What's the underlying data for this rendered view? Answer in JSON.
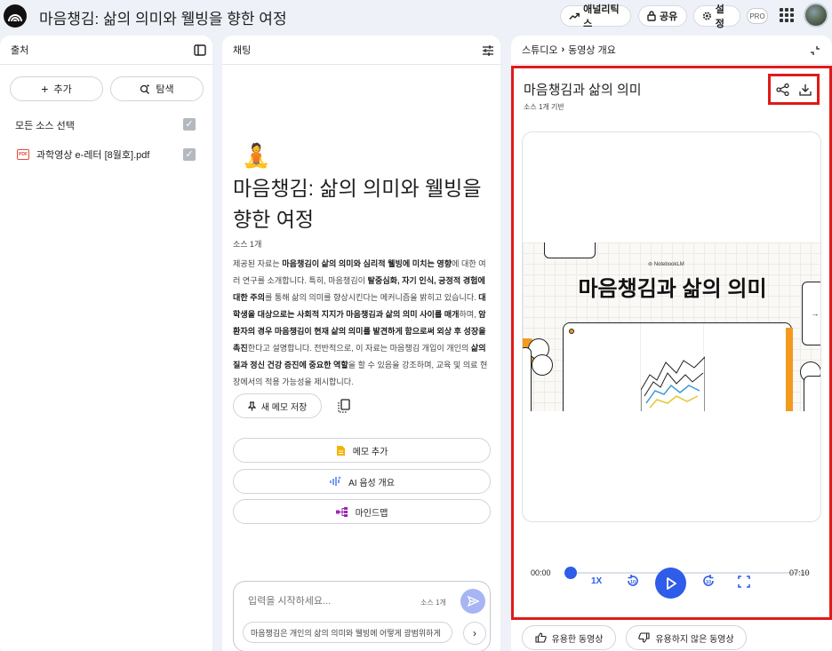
{
  "header": {
    "app_title": "마음챙김: 삶의 의미와 웰빙을 향한 여정",
    "analytics_label": "애널리틱스",
    "share_label": "공유",
    "settings_label": "설정",
    "plan_badge": "PRO"
  },
  "sources": {
    "title": "출처",
    "add_label": "추가",
    "explore_label": "탐색",
    "select_all_label": "모든 소스 선택",
    "items": [
      {
        "name": "과학영상 e-레터 [8월호].pdf",
        "type_badge": "PDF"
      }
    ]
  },
  "chat": {
    "title": "채팅",
    "notebook_emoji": "🧘",
    "notebook_title": "마음챙김: 삶의 의미와 웰빙을 향한 여정",
    "source_count": "소스 1개",
    "summary": [
      {
        "t": "제공된 자료는 ",
        "b": false
      },
      {
        "t": "마음챙김이 삶의 의미와 심리적 웰빙에 미치는 영향",
        "b": true
      },
      {
        "t": "에 대한 여러 연구를 소개합니다. 특히, 마음챙김이 ",
        "b": false
      },
      {
        "t": "탈중심화, 자기 인식, 긍정적 경험에 대한 주의",
        "b": true
      },
      {
        "t": "를 통해 삶의 의미를 향상시킨다는 메커니즘을 밝히고 있습니다. ",
        "b": false
      },
      {
        "t": "대학생을 대상으로는 사회적 지지가 마음챙김과 삶의 의미 사이를 매개",
        "b": true
      },
      {
        "t": "하며, ",
        "b": false
      },
      {
        "t": "암 환자의 경우 마음챙김이 현재 삶의 의미를 발견하게 함으로써 외상 후 성장을 촉진",
        "b": true
      },
      {
        "t": "한다고 설명합니다. 전반적으로, 이 자료는 마음챙김 개입이 개인의 ",
        "b": false
      },
      {
        "t": "삶의 질과 정신 건강 증진에 중요한 역할",
        "b": true
      },
      {
        "t": "을 할 수 있음을 강조하며, 교육 및 의료 현장에서의 적용 가능성을 제시합니다.",
        "b": false
      }
    ],
    "save_note_label": "새 메모 저장",
    "add_note_label": "메모 추가",
    "audio_overview_label": "AI 음성 개요",
    "mindmap_label": "마인드맵",
    "input_placeholder": "입력을 시작하세요...",
    "input_source_count": "소스 1개",
    "suggestion": "마음챙김은 개인의 삶의 의미와 웰빙에 어떻게 광범위하게"
  },
  "studio": {
    "breadcrumb_root": "스튜디오",
    "breadcrumb_current": "동영상 개요",
    "video_title": "마음챙김과 삶의 의미",
    "video_subtitle": "소스 1개 기반",
    "slide_brand": "NotebookLM",
    "slide_title": "마음챙김과 삶의 의미",
    "time_current": "00:00",
    "time_total": "07:10",
    "playback_progress": 0,
    "speed_label": "1X",
    "rewind_label": "10",
    "forward_label": "10",
    "like_label": "유용한 동영상",
    "dislike_label": "유용하지 않은 동영상"
  },
  "colors": {
    "accent_blue": "#2f5ce8",
    "highlight_red": "#e01a1a",
    "slide_orange": "#f39a1f"
  }
}
